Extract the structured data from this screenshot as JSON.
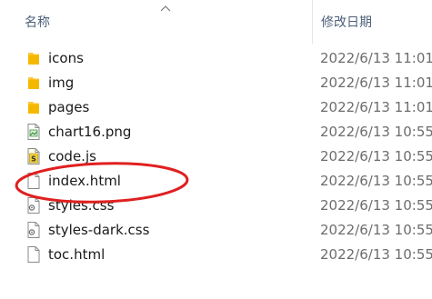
{
  "columns": {
    "name": "名称",
    "modified": "修改日期"
  },
  "files": [
    {
      "name": "icons",
      "date": "2022/6/13 11:01",
      "icon": "folder-icon"
    },
    {
      "name": "img",
      "date": "2022/6/13 11:01",
      "icon": "folder-icon"
    },
    {
      "name": "pages",
      "date": "2022/6/13 11:01",
      "icon": "folder-icon"
    },
    {
      "name": "chart16.png",
      "date": "2022/6/13 10:55",
      "icon": "png-file-icon"
    },
    {
      "name": "code.js",
      "date": "2022/6/13 10:55",
      "icon": "js-file-icon"
    },
    {
      "name": "index.html",
      "date": "2022/6/13 10:55",
      "icon": "html-file-icon"
    },
    {
      "name": "styles.css",
      "date": "2022/6/13 10:55",
      "icon": "css-file-icon"
    },
    {
      "name": "styles-dark.css",
      "date": "2022/6/13 10:55",
      "icon": "css-file-icon"
    },
    {
      "name": "toc.html",
      "date": "2022/6/13 10:55",
      "icon": "html-file-icon"
    }
  ],
  "colors": {
    "folder": "#ffc83d",
    "annotation": "#e02020",
    "header_text": "#4c607a"
  }
}
